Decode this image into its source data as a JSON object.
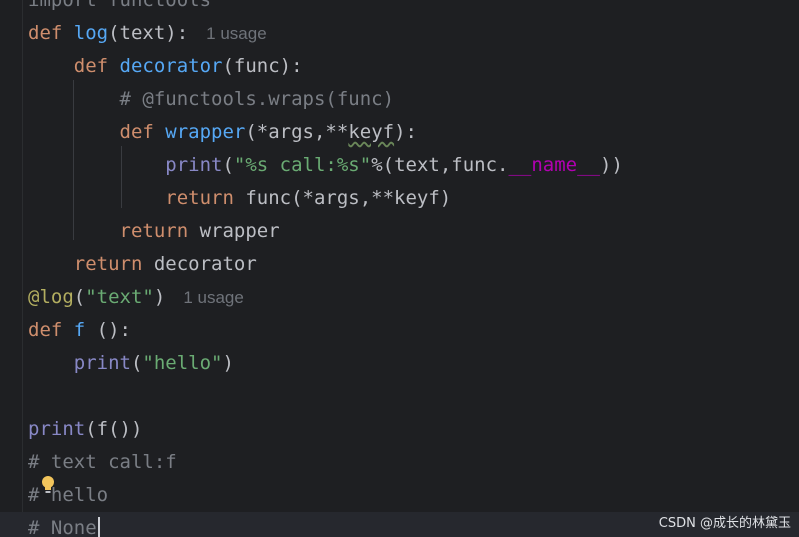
{
  "lines": [
    {
      "id": "l0",
      "tokens": [
        {
          "t": "import functools",
          "c": "cm"
        }
      ]
    },
    {
      "id": "l1",
      "tokens": [
        {
          "t": "def ",
          "c": "kw"
        },
        {
          "t": "log",
          "c": "fn"
        },
        {
          "t": "(text):",
          "c": "plain"
        }
      ],
      "usage": "1 usage"
    },
    {
      "id": "l2",
      "tokens": [
        {
          "t": "    def ",
          "c": "kw"
        },
        {
          "t": "decorator",
          "c": "fn"
        },
        {
          "t": "(func):",
          "c": "plain"
        }
      ]
    },
    {
      "id": "l3",
      "tokens": [
        {
          "t": "        # @functools.wraps(func)",
          "c": "cm"
        }
      ]
    },
    {
      "id": "l4",
      "tokens": [
        {
          "t": "        def ",
          "c": "kw"
        },
        {
          "t": "wrapper",
          "c": "fn"
        },
        {
          "t": "(*args,**",
          "c": "plain"
        },
        {
          "t": "keyf",
          "c": "plain",
          "warn": true
        },
        {
          "t": "):",
          "c": "plain"
        }
      ]
    },
    {
      "id": "l5",
      "tokens": [
        {
          "t": "            print",
          "c": "builtin"
        },
        {
          "t": "(",
          "c": "plain"
        },
        {
          "t": "\"%s call:%s\"",
          "c": "str"
        },
        {
          "t": "%(text,func.",
          "c": "plain"
        },
        {
          "t": "__name__",
          "c": "dunder"
        },
        {
          "t": "))",
          "c": "plain"
        }
      ]
    },
    {
      "id": "l6",
      "tokens": [
        {
          "t": "            return ",
          "c": "kw"
        },
        {
          "t": "func(*args,**keyf)",
          "c": "plain"
        }
      ]
    },
    {
      "id": "l7",
      "tokens": [
        {
          "t": "        return ",
          "c": "kw"
        },
        {
          "t": "wrapper",
          "c": "plain"
        }
      ]
    },
    {
      "id": "l8",
      "tokens": [
        {
          "t": "    return ",
          "c": "kw"
        },
        {
          "t": "decorator",
          "c": "plain"
        }
      ]
    },
    {
      "id": "l9",
      "tokens": [
        {
          "t": "@log",
          "c": "deco"
        },
        {
          "t": "(",
          "c": "plain"
        },
        {
          "t": "\"text\"",
          "c": "str"
        },
        {
          "t": ")",
          "c": "plain"
        }
      ],
      "usage": "1 usage"
    },
    {
      "id": "l10",
      "tokens": [
        {
          "t": "def ",
          "c": "kw"
        },
        {
          "t": "f ",
          "c": "fn"
        },
        {
          "t": "():",
          "c": "plain"
        }
      ]
    },
    {
      "id": "l11",
      "tokens": [
        {
          "t": "    print",
          "c": "builtin"
        },
        {
          "t": "(",
          "c": "plain"
        },
        {
          "t": "\"hello\"",
          "c": "str"
        },
        {
          "t": ")",
          "c": "plain"
        }
      ]
    },
    {
      "id": "l12",
      "tokens": []
    },
    {
      "id": "l13",
      "tokens": [
        {
          "t": "print",
          "c": "builtin"
        },
        {
          "t": "(f())",
          "c": "plain"
        }
      ]
    },
    {
      "id": "l14",
      "tokens": [
        {
          "t": "# text call:f",
          "c": "cm"
        }
      ]
    },
    {
      "id": "l15",
      "tokens": [
        {
          "t": "# hello",
          "c": "cm"
        }
      ]
    },
    {
      "id": "l16",
      "tokens": [
        {
          "t": "# None",
          "c": "cm"
        }
      ],
      "current": true
    }
  ],
  "icons": {
    "intention_bulb": "lightbulb-icon"
  },
  "colors": {
    "background": "#1e1f22",
    "keyword": "#cf8e6d",
    "function": "#56a8f5",
    "string": "#6aab73",
    "comment": "#7a7e85",
    "decorator": "#b3ae60",
    "builtin": "#8888c6",
    "dunder": "#b200b2"
  },
  "watermark": "CSDN @成长的林黛玉"
}
